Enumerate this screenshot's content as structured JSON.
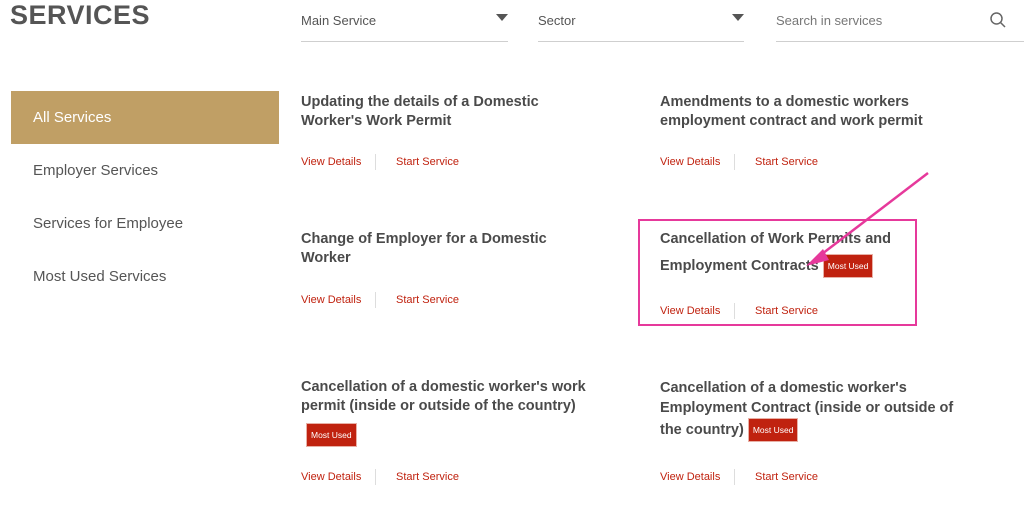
{
  "header": {
    "title": "SERVICES"
  },
  "filters": {
    "main_service": "Main Service",
    "sector": "Sector",
    "search_placeholder": "Search in services"
  },
  "sidebar": {
    "items": [
      {
        "label": "All Services",
        "active": true
      },
      {
        "label": "Employer Services"
      },
      {
        "label": "Services for Employee"
      },
      {
        "label": "Most Used Services"
      }
    ]
  },
  "services": [
    {
      "title": "Updating the details of a Domestic Worker's Work Permit",
      "view": "View Details",
      "start": "Start Service"
    },
    {
      "title": "Amendments to a domestic workers employment contract and work permit",
      "view": "View Details",
      "start": "Start Service"
    },
    {
      "title": "Change of Employer for a Domestic Worker",
      "view": "View Details",
      "start": "Start Service"
    },
    {
      "title": "Cancellation of Work Permits and Employment Contracts",
      "badge": "Most Used",
      "view": "View Details",
      "start": "Start Service"
    },
    {
      "title": "Cancellation of a domestic worker's work permit (inside or outside of the country)",
      "badge": "Most Used",
      "view": "View Details",
      "start": "Start Service"
    },
    {
      "title": "Cancellation of a domestic worker's Employment Contract (inside or outside of the country)",
      "badge": "Most Used",
      "view": "View Details",
      "start": "Start Service"
    }
  ],
  "colors": {
    "accent": "#c09f65",
    "link": "#c0220f",
    "badge": "#c0220f",
    "annotation": "#e6399b"
  }
}
